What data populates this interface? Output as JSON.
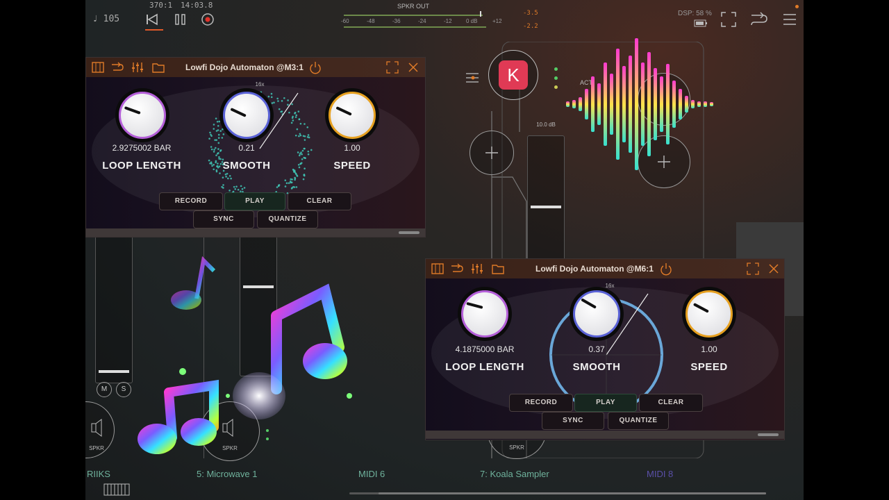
{
  "topbar": {
    "tempo": "♩ 105",
    "position": "370:1",
    "time": "14:03.8",
    "meter_title": "SPKR OUT",
    "meter_scale": [
      "-60",
      "-48",
      "-36",
      "-24",
      "-12",
      "0 dB",
      "+12"
    ],
    "meter_top_value": "-3.5",
    "meter_bottom_value": "-2.2",
    "dsp": "DSP: 58 %"
  },
  "panel1": {
    "title": "Lowfi Dojo Automaton @M3:1",
    "loop_value": "2.9275002 BAR",
    "loop_label": "LOOP LENGTH",
    "smooth_value": "0.21",
    "smooth_label": "SMOOTH",
    "speed_value": "1.00",
    "speed_label": "SPEED",
    "sixteen_x": "16x",
    "buttons": {
      "record": "RECORD",
      "play": "PLAY",
      "clear": "CLEAR",
      "sync": "SYNC",
      "quantize": "QUANTIZE"
    }
  },
  "panel2": {
    "title": "Lowfi Dojo Automaton @M6:1",
    "loop_value": "4.1875000 BAR",
    "loop_label": "LOOP LENGTH",
    "smooth_value": "0.37",
    "smooth_label": "SMOOTH",
    "speed_value": "1.00",
    "speed_label": "SPEED",
    "sixteen_x": "16x",
    "buttons": {
      "record": "RECORD",
      "play": "PLAY",
      "clear": "CLEAR",
      "sync": "SYNC",
      "quantize": "QUANTIZE"
    }
  },
  "mixer": {
    "fader_db": "10.0 dB",
    "k_label": "K",
    "mute": "M",
    "solo": "S",
    "spkr": "SPKR",
    "active": "ACTI"
  },
  "tracks": [
    {
      "label": "RIIKS",
      "color": "#6fb29c"
    },
    {
      "label": "5: Microwave 1",
      "color": "#6fb29c"
    },
    {
      "label": "MIDI 6",
      "color": "#6fb29c"
    },
    {
      "label": "7: Koala Sampler",
      "color": "#6fb29c"
    },
    {
      "label": "MIDI 8",
      "color": "#5a4fa8"
    }
  ],
  "colors": {
    "accent_orange": "#e07b28",
    "knob_purple": "#b45fd8",
    "knob_blue": "#5a62d6",
    "knob_orange": "#e6a020",
    "ring_teal": "#3fc5b5",
    "ring_blue": "#6aa7d8"
  }
}
